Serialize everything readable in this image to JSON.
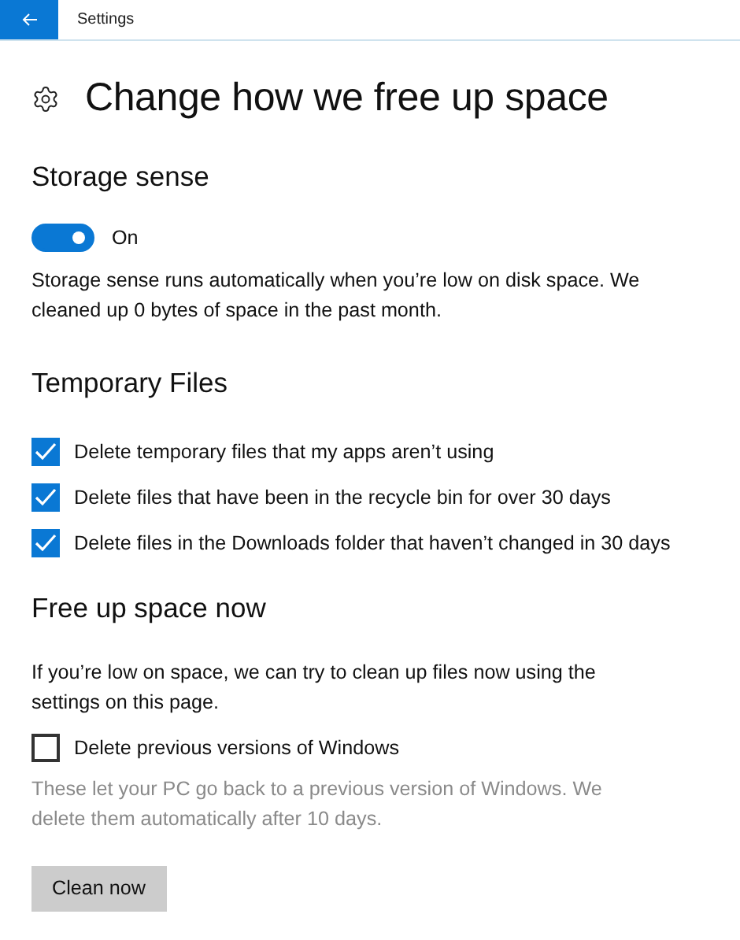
{
  "title_bar": {
    "title": "Settings"
  },
  "page": {
    "title": "Change how we free up space"
  },
  "storage_sense": {
    "heading": "Storage sense",
    "toggle": {
      "on": true,
      "label": "On"
    },
    "description": "Storage sense runs automatically when you’re low on disk space. We cleaned up 0 bytes of space in the past month."
  },
  "temporary_files": {
    "heading": "Temporary Files",
    "options": [
      {
        "label": "Delete temporary files that my apps aren’t using",
        "checked": true
      },
      {
        "label": "Delete files that have been in the recycle bin for over 30 days",
        "checked": true
      },
      {
        "label": "Delete files in the Downloads folder that haven’t changed in 30 days",
        "checked": true
      }
    ]
  },
  "free_up_space_now": {
    "heading": "Free up space now",
    "description": "If you’re low on space, we can try to clean up files now using the settings on this page.",
    "option": {
      "label": "Delete previous versions of Windows",
      "checked": false
    },
    "note": "These let your PC go back to a previous version of Windows. We delete them automatically after 10 days.",
    "button": "Clean now"
  }
}
